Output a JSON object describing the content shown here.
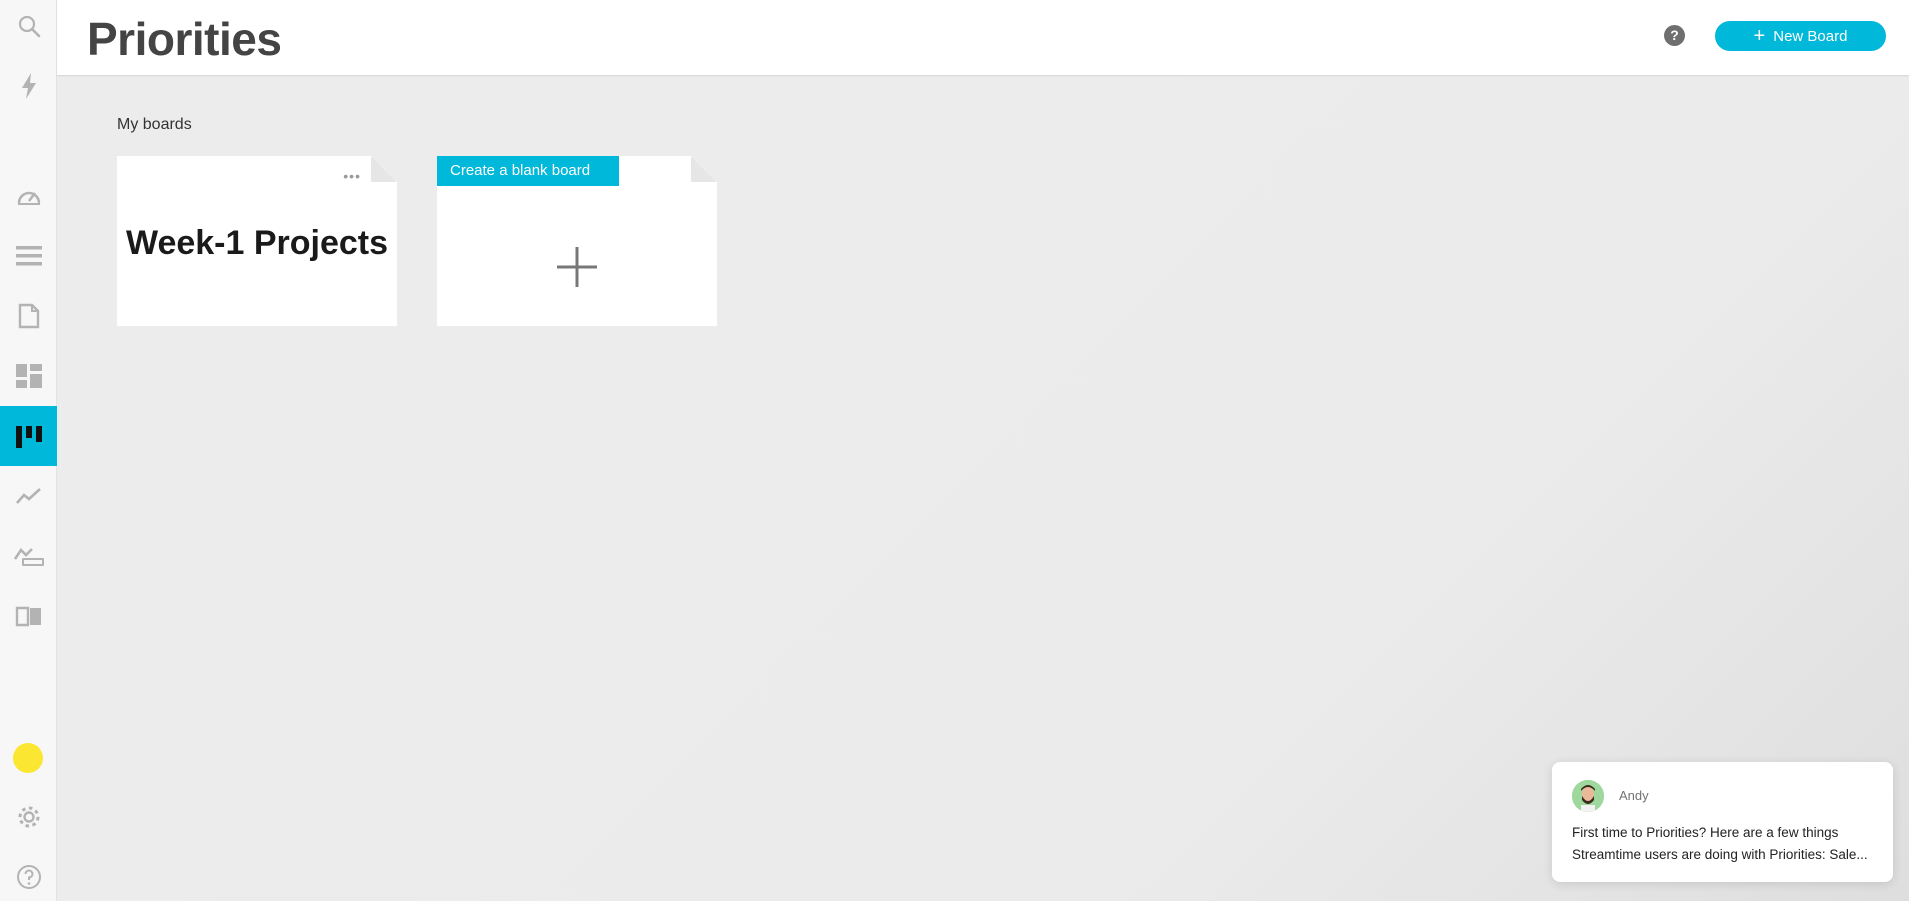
{
  "header": {
    "title": "Priorities",
    "help_symbol": "?",
    "new_board_label": "New Board"
  },
  "sidebar": {
    "items": [
      {
        "icon": "search-icon",
        "active": false
      },
      {
        "icon": "lightning-icon",
        "active": false
      },
      {
        "icon": "dashboard-gauge-icon",
        "active": false
      },
      {
        "icon": "list-icon",
        "active": false
      },
      {
        "icon": "document-icon",
        "active": false
      },
      {
        "icon": "layout-icon",
        "active": false
      },
      {
        "icon": "board-icon",
        "active": true
      },
      {
        "icon": "trend-chart-icon",
        "active": false
      },
      {
        "icon": "new-report-icon",
        "active": false
      },
      {
        "icon": "book-icon",
        "active": false
      },
      {
        "icon": "settings-gear-icon",
        "active": false
      },
      {
        "icon": "help-circle-icon",
        "active": false
      }
    ],
    "avatar_color": "#fbe731",
    "accent_color": "#00b8d9"
  },
  "main": {
    "section_label": "My boards",
    "boards": [
      {
        "title": "Week-1 Projects",
        "menu": "•••"
      }
    ],
    "blank_board_label": "Create a blank board"
  },
  "chat": {
    "sender": "Andy",
    "message_line1": "First time to Priorities? Here are a few things",
    "message_line2": "Streamtime users are doing with Priorities: Sale..."
  }
}
